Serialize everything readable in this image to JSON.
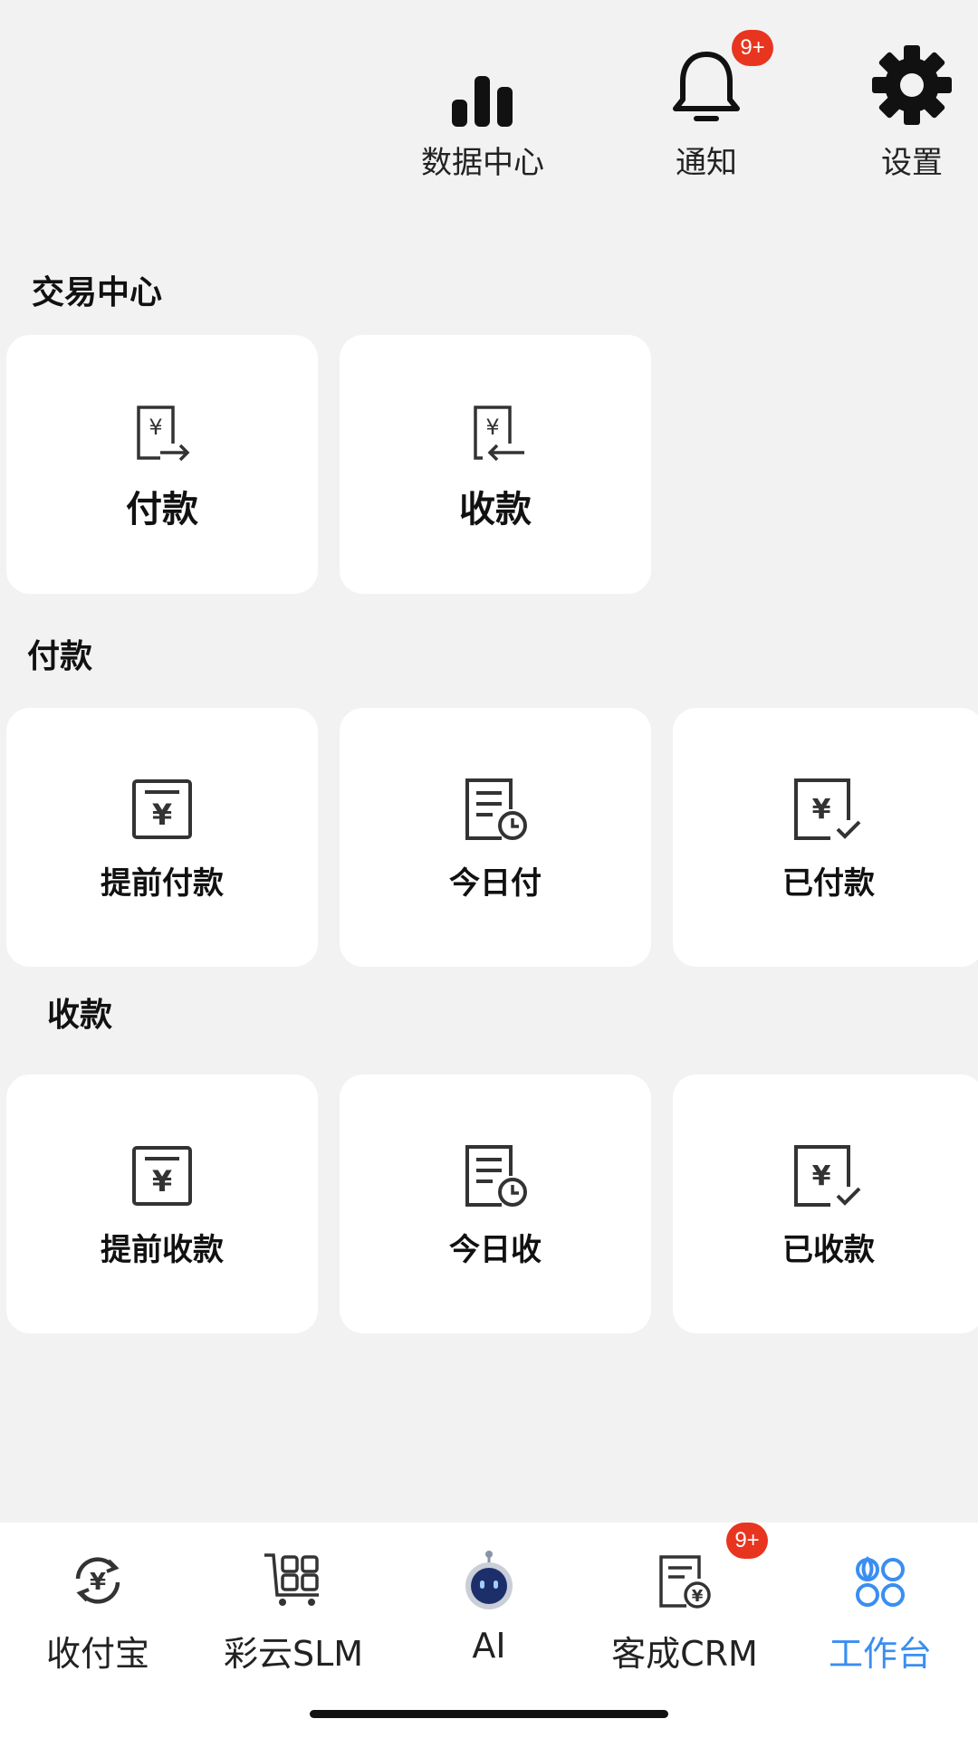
{
  "top_actions": [
    {
      "label": "数据中心",
      "icon": "bar-chart-icon"
    },
    {
      "label": "通知",
      "icon": "bell-icon",
      "badge": "9+"
    },
    {
      "label": "设置",
      "icon": "gear-icon"
    }
  ],
  "sections": {
    "trade": {
      "title": "交易中心",
      "cards": [
        {
          "label": "付款",
          "icon": "pay-out-icon"
        },
        {
          "label": "收款",
          "icon": "pay-in-icon"
        }
      ]
    },
    "payment": {
      "title": "付款",
      "cards": [
        {
          "label": "提前付款",
          "icon": "yen-doc-icon"
        },
        {
          "label": "今日付",
          "icon": "doc-clock-icon"
        },
        {
          "label": "已付款",
          "icon": "yen-check-icon"
        }
      ]
    },
    "receipt": {
      "title": "收款",
      "cards": [
        {
          "label": "提前收款",
          "icon": "yen-doc-icon"
        },
        {
          "label": "今日收",
          "icon": "doc-clock-icon"
        },
        {
          "label": "已收款",
          "icon": "yen-check-icon"
        }
      ]
    }
  },
  "bottom_nav": [
    {
      "label": "收付宝",
      "icon": "yen-cycle-icon"
    },
    {
      "label": "彩云SLM",
      "icon": "cart-grid-icon"
    },
    {
      "label": "AI",
      "icon": "robot-icon"
    },
    {
      "label": "客成CRM",
      "icon": "crm-doc-icon",
      "badge": "9+"
    },
    {
      "label": "工作台",
      "icon": "workbench-icon",
      "active": true
    }
  ],
  "colors": {
    "accent": "#3a8ef0",
    "badge": "#e8351f",
    "background": "#f2f2f2"
  }
}
